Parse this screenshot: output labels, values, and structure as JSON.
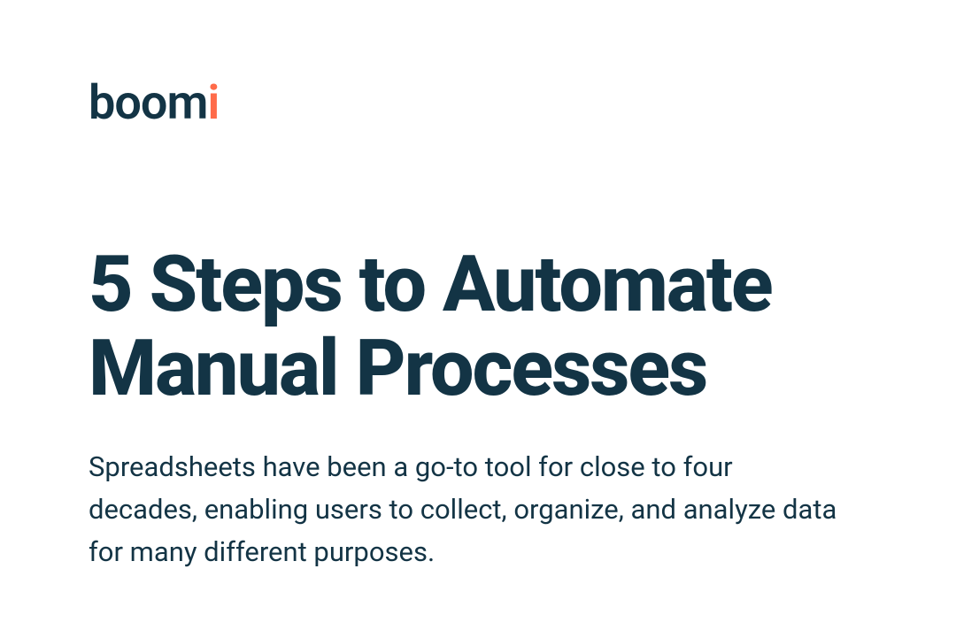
{
  "brand": {
    "name_prefix": "boom",
    "name_suffix": "i"
  },
  "title": "5 Steps to Automate Manual Processes",
  "subtitle": "Spreadsheets have been a go-to tool for close to four decades, enabling users to collect, organize, and analyze data for many different purposes.",
  "colors": {
    "text_primary": "#133445",
    "accent": "#FF6B4A",
    "background": "#ffffff"
  }
}
